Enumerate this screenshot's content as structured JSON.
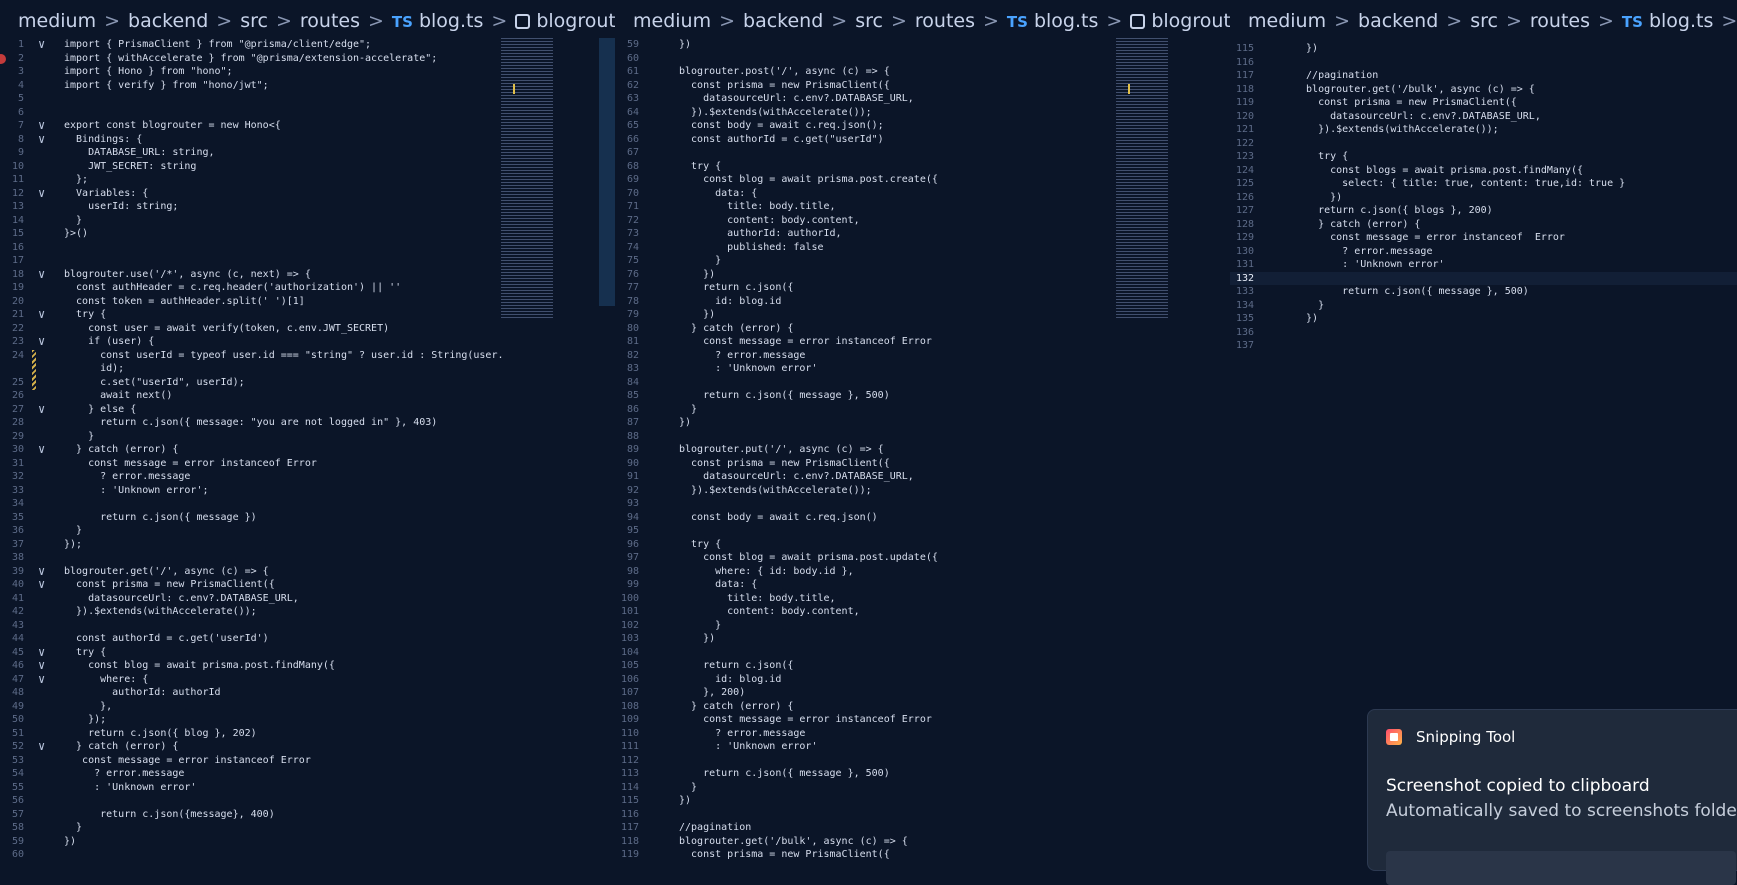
{
  "breadcrumb": {
    "segments": [
      "medium",
      "backend",
      "src",
      "routes"
    ],
    "file_badge": "TS",
    "file": "blog.ts",
    "symbol": "blogrouter.get("
  },
  "panes": [
    {
      "lines": [
        {
          "n": "1",
          "t": "import { PrismaClient } from \"@prisma/client/edge\";",
          "fold": true
        },
        {
          "n": "2",
          "t": "import { withAccelerate } from \"@prisma/extension-accelerate\";"
        },
        {
          "n": "3",
          "t": "import { Hono } from \"hono\";"
        },
        {
          "n": "4",
          "t": "import { verify } from \"hono/jwt\";"
        },
        {
          "n": "5",
          "t": ""
        },
        {
          "n": "6",
          "t": ""
        },
        {
          "n": "7",
          "t": "export const blogrouter = new Hono<{",
          "fold": true
        },
        {
          "n": "8",
          "t": "  Bindings: {",
          "fold": true
        },
        {
          "n": "9",
          "t": "    DATABASE_URL: string,"
        },
        {
          "n": "10",
          "t": "    JWT_SECRET: string"
        },
        {
          "n": "11",
          "t": "  };"
        },
        {
          "n": "12",
          "t": "  Variables: {",
          "fold": true
        },
        {
          "n": "13",
          "t": "    userId: string;"
        },
        {
          "n": "14",
          "t": "  }"
        },
        {
          "n": "15",
          "t": "}>()"
        },
        {
          "n": "16",
          "t": ""
        },
        {
          "n": "17",
          "t": ""
        },
        {
          "n": "18",
          "t": "blogrouter.use('/*', async (c, next) => {",
          "fold": true
        },
        {
          "n": "19",
          "t": "  const authHeader = c.req.header('authorization') || ''"
        },
        {
          "n": "20",
          "t": "  const token = authHeader.split(' ')[1]"
        },
        {
          "n": "21",
          "t": "  try {",
          "fold": true
        },
        {
          "n": "22",
          "t": "    const user = await verify(token, c.env.JWT_SECRET)"
        },
        {
          "n": "23",
          "t": "    if (user) {",
          "fold": true
        },
        {
          "n": "24",
          "t": "      const userId = typeof user.id === \"string\" ? user.id : String(user."
        },
        {
          "n": "",
          "t": "      id);"
        },
        {
          "n": "25",
          "t": "      c.set(\"userId\", userId);"
        },
        {
          "n": "26",
          "t": "      await next()"
        },
        {
          "n": "27",
          "t": "    } else {",
          "fold": true
        },
        {
          "n": "28",
          "t": "      return c.json({ message: \"you are not logged in\" }, 403)"
        },
        {
          "n": "29",
          "t": "    }"
        },
        {
          "n": "30",
          "t": "  } catch (error) {",
          "fold": true
        },
        {
          "n": "31",
          "t": "    const message = error instanceof Error"
        },
        {
          "n": "32",
          "t": "      ? error.message"
        },
        {
          "n": "33",
          "t": "      : 'Unknown error';"
        },
        {
          "n": "34",
          "t": ""
        },
        {
          "n": "35",
          "t": "      return c.json({ message })"
        },
        {
          "n": "36",
          "t": "  }"
        },
        {
          "n": "37",
          "t": "});"
        },
        {
          "n": "38",
          "t": ""
        },
        {
          "n": "39",
          "t": "blogrouter.get('/', async (c) => {",
          "fold": true
        },
        {
          "n": "40",
          "t": "  const prisma = new PrismaClient({",
          "fold": true
        },
        {
          "n": "41",
          "t": "    datasourceUrl: c.env?.DATABASE_URL,"
        },
        {
          "n": "42",
          "t": "  }).$extends(withAccelerate());"
        },
        {
          "n": "43",
          "t": ""
        },
        {
          "n": "44",
          "t": "  const authorId = c.get('userId')"
        },
        {
          "n": "45",
          "t": "  try {",
          "fold": true
        },
        {
          "n": "46",
          "t": "    const blog = await prisma.post.findMany({",
          "fold": true
        },
        {
          "n": "47",
          "t": "      where: {",
          "fold": true
        },
        {
          "n": "48",
          "t": "        authorId: authorId"
        },
        {
          "n": "49",
          "t": "      },"
        },
        {
          "n": "50",
          "t": "    });"
        },
        {
          "n": "51",
          "t": "    return c.json({ blog }, 202)"
        },
        {
          "n": "52",
          "t": "  } catch (error) {",
          "fold": true
        },
        {
          "n": "53",
          "t": "   const message = error instanceof Error"
        },
        {
          "n": "54",
          "t": "     ? error.message"
        },
        {
          "n": "55",
          "t": "     : 'Unknown error'"
        },
        {
          "n": "56",
          "t": ""
        },
        {
          "n": "57",
          "t": "      return c.json({message}, 400)"
        },
        {
          "n": "58",
          "t": "  }"
        },
        {
          "n": "59",
          "t": "})"
        },
        {
          "n": "60",
          "t": ""
        }
      ]
    },
    {
      "lines": [
        {
          "n": "59",
          "t": "})"
        },
        {
          "n": "60",
          "t": ""
        },
        {
          "n": "61",
          "t": "blogrouter.post('/', async (c) => {"
        },
        {
          "n": "62",
          "t": "  const prisma = new PrismaClient({"
        },
        {
          "n": "63",
          "t": "    datasourceUrl: c.env?.DATABASE_URL,"
        },
        {
          "n": "64",
          "t": "  }).$extends(withAccelerate());"
        },
        {
          "n": "65",
          "t": "  const body = await c.req.json();"
        },
        {
          "n": "66",
          "t": "  const authorId = c.get(\"userId\")"
        },
        {
          "n": "67",
          "t": ""
        },
        {
          "n": "68",
          "t": "  try {"
        },
        {
          "n": "69",
          "t": "    const blog = await prisma.post.create({"
        },
        {
          "n": "70",
          "t": "      data: {"
        },
        {
          "n": "71",
          "t": "        title: body.title,"
        },
        {
          "n": "72",
          "t": "        content: body.content,"
        },
        {
          "n": "73",
          "t": "        authorId: authorId,"
        },
        {
          "n": "74",
          "t": "        published: false"
        },
        {
          "n": "75",
          "t": "      }"
        },
        {
          "n": "76",
          "t": "    })"
        },
        {
          "n": "77",
          "t": "    return c.json({"
        },
        {
          "n": "78",
          "t": "      id: blog.id"
        },
        {
          "n": "79",
          "t": "    })"
        },
        {
          "n": "80",
          "t": "  } catch (error) {"
        },
        {
          "n": "81",
          "t": "    const message = error instanceof Error"
        },
        {
          "n": "82",
          "t": "      ? error.message"
        },
        {
          "n": "83",
          "t": "      : 'Unknown error'"
        },
        {
          "n": "84",
          "t": ""
        },
        {
          "n": "85",
          "t": "    return c.json({ message }, 500)"
        },
        {
          "n": "86",
          "t": "  }"
        },
        {
          "n": "87",
          "t": "})"
        },
        {
          "n": "88",
          "t": ""
        },
        {
          "n": "89",
          "t": "blogrouter.put('/', async (c) => {"
        },
        {
          "n": "90",
          "t": "  const prisma = new PrismaClient({"
        },
        {
          "n": "91",
          "t": "    datasourceUrl: c.env?.DATABASE_URL,"
        },
        {
          "n": "92",
          "t": "  }).$extends(withAccelerate());"
        },
        {
          "n": "93",
          "t": ""
        },
        {
          "n": "94",
          "t": "  const body = await c.req.json()"
        },
        {
          "n": "95",
          "t": ""
        },
        {
          "n": "96",
          "t": "  try {"
        },
        {
          "n": "97",
          "t": "    const blog = await prisma.post.update({"
        },
        {
          "n": "98",
          "t": "      where: { id: body.id },"
        },
        {
          "n": "99",
          "t": "      data: {"
        },
        {
          "n": "100",
          "t": "        title: body.title,"
        },
        {
          "n": "101",
          "t": "        content: body.content,"
        },
        {
          "n": "102",
          "t": "      }"
        },
        {
          "n": "103",
          "t": "    })"
        },
        {
          "n": "104",
          "t": ""
        },
        {
          "n": "105",
          "t": "    return c.json({"
        },
        {
          "n": "106",
          "t": "      id: blog.id"
        },
        {
          "n": "107",
          "t": "    }, 200)"
        },
        {
          "n": "108",
          "t": "  } catch (error) {"
        },
        {
          "n": "109",
          "t": "    const message = error instanceof Error"
        },
        {
          "n": "110",
          "t": "      ? error.message"
        },
        {
          "n": "111",
          "t": "      : 'Unknown error'"
        },
        {
          "n": "112",
          "t": ""
        },
        {
          "n": "113",
          "t": "    return c.json({ message }, 500)"
        },
        {
          "n": "114",
          "t": "  }"
        },
        {
          "n": "115",
          "t": "})"
        },
        {
          "n": "116",
          "t": ""
        },
        {
          "n": "117",
          "t": "//pagination"
        },
        {
          "n": "118",
          "t": "blogrouter.get('/bulk', async (c) => {"
        },
        {
          "n": "119",
          "t": "  const prisma = new PrismaClient({"
        }
      ]
    },
    {
      "lines": [
        {
          "n": "115",
          "t": "  })"
        },
        {
          "n": "116",
          "t": ""
        },
        {
          "n": "117",
          "t": "  //pagination"
        },
        {
          "n": "118",
          "t": "  blogrouter.get('/bulk', async (c) => {"
        },
        {
          "n": "119",
          "t": "    const prisma = new PrismaClient({"
        },
        {
          "n": "120",
          "t": "      datasourceUrl: c.env?.DATABASE_URL,"
        },
        {
          "n": "121",
          "t": "    }).$extends(withAccelerate());"
        },
        {
          "n": "122",
          "t": ""
        },
        {
          "n": "123",
          "t": "    try {"
        },
        {
          "n": "124",
          "t": "      const blogs = await prisma.post.findMany({"
        },
        {
          "n": "125",
          "t": "        select: { title: true, content: true,id: true }"
        },
        {
          "n": "126",
          "t": "      })"
        },
        {
          "n": "127",
          "t": "    return c.json({ blogs }, 200)"
        },
        {
          "n": "128",
          "t": "    } catch (error) {"
        },
        {
          "n": "129",
          "t": "      const message = error instanceof  Error"
        },
        {
          "n": "130",
          "t": "        ? error.message"
        },
        {
          "n": "131",
          "t": "        : 'Unknown error'"
        },
        {
          "n": "132",
          "t": "",
          "current": true
        },
        {
          "n": "133",
          "t": "        return c.json({ message }, 500)"
        },
        {
          "n": "134",
          "t": "    }"
        },
        {
          "n": "135",
          "t": "  })"
        },
        {
          "n": "136",
          "t": ""
        },
        {
          "n": "137",
          "t": ""
        }
      ]
    }
  ],
  "toast": {
    "app": "Snipping Tool",
    "title": "Screenshot copied to clipboard",
    "subtitle": "Automatically saved to screenshots folder.",
    "more": "···"
  }
}
